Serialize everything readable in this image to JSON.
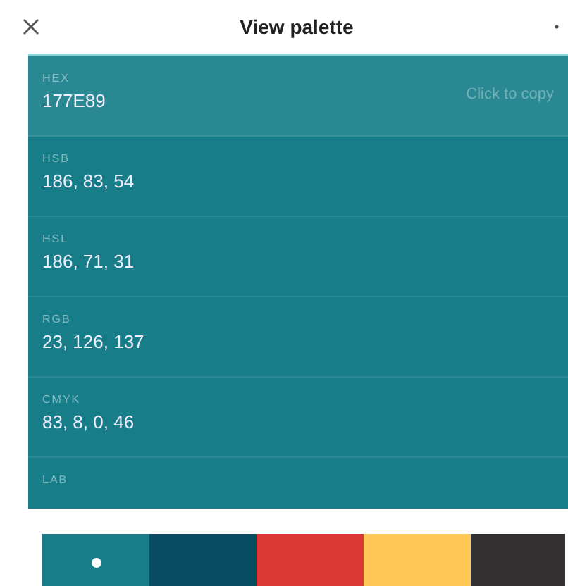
{
  "header": {
    "title": "View palette"
  },
  "formats": [
    {
      "label": "HEX",
      "value": "177E89",
      "selected": true,
      "hint": "Click to copy"
    },
    {
      "label": "HSB",
      "value": "186, 83, 54",
      "selected": false
    },
    {
      "label": "HSL",
      "value": "186, 71, 31",
      "selected": false
    },
    {
      "label": "RGB",
      "value": "23, 126, 137",
      "selected": false
    },
    {
      "label": "CMYK",
      "value": "83, 8, 0, 46",
      "selected": false
    },
    {
      "label": "LAB",
      "selected": false
    }
  ],
  "swatches": [
    {
      "color": "#177e89",
      "selected": true
    },
    {
      "color": "#084c61",
      "selected": false
    },
    {
      "color": "#db3a34",
      "selected": false
    },
    {
      "color": "#ffc857",
      "selected": false
    },
    {
      "color": "#323031",
      "selected": false
    }
  ]
}
